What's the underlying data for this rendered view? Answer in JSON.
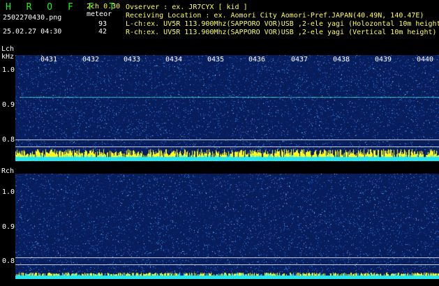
{
  "header": {
    "title": "H R O F F T",
    "filename": "2502270430.png",
    "timestamp": "25.02.27 04:30",
    "channel_mode": "2ch 0.30",
    "meteor_label": "meteor",
    "lch_count": "93",
    "rch_count": "42"
  },
  "info": {
    "observer": "Ovserver          : ex. JR7CYX [ kid ]",
    "location": "Receiving Location : ex. Aomori City Aomori-Pref.JAPAN(40.49N, 140.47E)",
    "lch": "L-ch:ex. UV5R 113.900Mhz(SAPPORO VOR)USB ,2-ele yagi (Holozontal 10m height)",
    "rch": "R-ch:ex. UV5R 113.900Mhz(SAPPORO VOR)USB ,2-ele yagi (Vertical 10m height)"
  },
  "lch_panel": {
    "label": "Lch",
    "unit": "kHz",
    "yticks": [
      "1.0",
      "0.9",
      "0.8"
    ]
  },
  "rch_panel": {
    "label": "Rch",
    "yticks": [
      "1.0",
      "0.9",
      "0.8"
    ]
  },
  "time_ticks": [
    "0431",
    "0432",
    "0433",
    "0434",
    "0435",
    "0436",
    "0437",
    "0438",
    "0439",
    "0440"
  ],
  "colors": {
    "background": "#000000",
    "waterfall": "#081d5c",
    "title": "#22ee22",
    "info": "#ffff55",
    "signal_cyan": "#22e6f0",
    "signal_yellow": "#ffff22"
  }
}
